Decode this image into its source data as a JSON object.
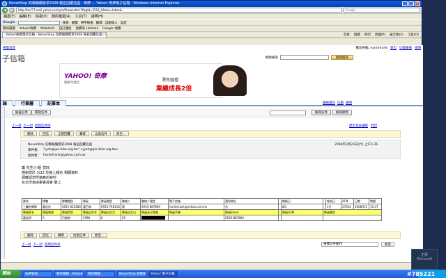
{
  "window": {
    "title": "NeverStop 鈞霖報價需求2008 報名回覆信函 - 奇摩 ... Yahoo! 奇摩電子信箱 - Windows Internet Explorer",
    "url": "http://tw.f77.mail.yahoo.com/ym/ShowLetter?MsgId=2518_0&box=Inbox&...",
    "ie_search_placeholder": "Google"
  },
  "menus": [
    "檔案(F)",
    "編輯(E)",
    "檢視(V)",
    "我的最愛(A)",
    "工具(T)",
    "說明(H)"
  ],
  "google_toolbar": {
    "label": "Google",
    "items": [
      "搜尋",
      "書籤",
      "拼字檢查",
      "翻譯",
      "自動填入",
      "設定"
    ]
  },
  "favorites": [
    "我的最愛",
    "Yahoo!奇摩",
    "Mobile01",
    "自訂連結",
    "免費的 Hotmail",
    "Google 地圖"
  ],
  "tab": {
    "label": "Yahoo!奇摩電子信箱 - NeverStop 鈞霖報價需求2008 報名回覆信函 - 奇摩"
  },
  "tab_tools": [
    "首頁",
    "回饋",
    "列印",
    "頁面(P)",
    "安全性(S)",
    "工具(O)"
  ],
  "top": {
    "left": "奇摩首頁",
    "greeting": "歡迎光臨, harlinfrank",
    "logout": "登出",
    "switch": "切換帳號",
    "help": "說明"
  },
  "mail": {
    "title": "子信箱",
    "web_search_label": "網頁搜尋",
    "web_search_button": "網頁搜尋"
  },
  "ad": {
    "brand": "YAHOO! 奇摩",
    "brand_sub": "關鍵字廣告",
    "line1": "漂亮婚禮",
    "line2": "業績成長2倍"
  },
  "tabs": [
    "錄",
    "行事曆",
    "記事本"
  ],
  "shortcuts": [
    "聯絡資訊",
    "信箱",
    "選項"
  ],
  "toolbar": {
    "check_mail": "檢查信件",
    "compose": "撰寫信件",
    "search_mail": "搜尋信件",
    "search_web": "搜尋網頁"
  },
  "nav": {
    "prev": "上一封",
    "next": "下一封",
    "back": "回到信件夾",
    "full_header": "標示為未讀取",
    "print": "列印"
  },
  "actions": [
    "刪除",
    "回信",
    "全部回覆",
    "轉寄",
    "垃圾信件",
    "移至..."
  ],
  "header": {
    "subject": "NeverStop 鈞霖報價需求2008 報名回覆信函",
    "date": "2008年3月22日(六) 上午5:36",
    "from_label": "寄件者:",
    "from": "\"jyoh@ipe-bike.org.tw\" <jyoh@ipe-bike.org.tw>",
    "to_label": "收件者:",
    "to": "harlinfrank@yahoo.com.tw"
  },
  "body": [
    "蕭 先生/小姐 您好,",
    "感謝您於 3/22 於線上報名 相關資料",
    "請確認您所填寫的資料",
    "",
    "台北市自由車委員會 敬上"
  ],
  "table": {
    "header": [
      "隊名",
      "隊職",
      "隊職電話",
      "隊員",
      "隊員電話",
      "聯絡人",
      "聯絡人電話",
      "電子信箱",
      "通訊地址",
      "",
      "報帳日",
      "",
      "報名日",
      "ATM",
      "日期",
      "時間"
    ],
    "row1": [
      "三麗哈喝隊",
      "蕭佳良",
      "0921-622580",
      "蕭百林",
      "0955-748110",
      "蕭",
      "0933-887860",
      "harlinfrank@yahoo.com.tw",
      "台",
      "",
      "8月",
      "",
      "1日",
      "27654",
      "2008/5/1",
      "15:47"
    ],
    "header2": [
      "隊員姓名",
      "隊員報號",
      "隊員性別",
      "隊員出生年",
      "隊員出生月",
      "隊員出生日",
      "隊員身分證號",
      "隊員手機",
      "隊員Email",
      "",
      "隊員GSM",
      "隊員備註"
    ],
    "row2": [
      "蕭佳明",
      "A",
      "已刪除",
      "1980",
      "8",
      "20",
      "",
      "",
      "0933-887860",
      "",
      "",
      ""
    ]
  },
  "bottom": {
    "select_label": "選擇信件動作",
    "move": "移至"
  },
  "taskbar": {
    "start": "開始",
    "tasks": [
      "任務管理",
      "我的電腦 - Mobile01",
      "我的電腦",
      "NeverStop 鈞霖報價",
      "Yahoo! 電子信箱"
    ]
  },
  "badge": {
    "line1": "正版",
    "line2": "Microsoft"
  },
  "watermark": "#785221"
}
